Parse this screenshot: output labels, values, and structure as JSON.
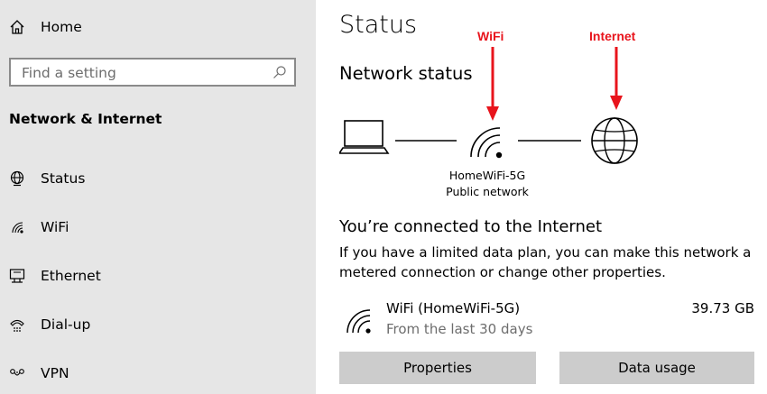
{
  "sidebar": {
    "home_label": "Home",
    "search_placeholder": "Find a setting",
    "section_title": "Network & Internet",
    "items": [
      {
        "label": "Status",
        "icon": "status-globe-icon"
      },
      {
        "label": "WiFi",
        "icon": "wifi-icon"
      },
      {
        "label": "Ethernet",
        "icon": "ethernet-icon"
      },
      {
        "label": "Dial-up",
        "icon": "dial-up-icon"
      },
      {
        "label": "VPN",
        "icon": "vpn-icon"
      }
    ]
  },
  "main": {
    "title": "Status",
    "network_status_heading": "Network status",
    "annotations": {
      "wifi": "WiFi",
      "internet": "Internet",
      "color": "#e8141c"
    },
    "network_name": "HomeWiFi-5G",
    "network_type": "Public network",
    "connected_heading": "You’re connected to the Internet",
    "description": "If you have a limited data plan, you can make this network a metered connection or change other properties.",
    "connection": {
      "name": "WiFi (HomeWiFi-5G)",
      "period": "From the last 30 days",
      "usage": "39.73 GB"
    },
    "buttons": {
      "properties": "Properties",
      "data_usage": "Data usage"
    }
  }
}
